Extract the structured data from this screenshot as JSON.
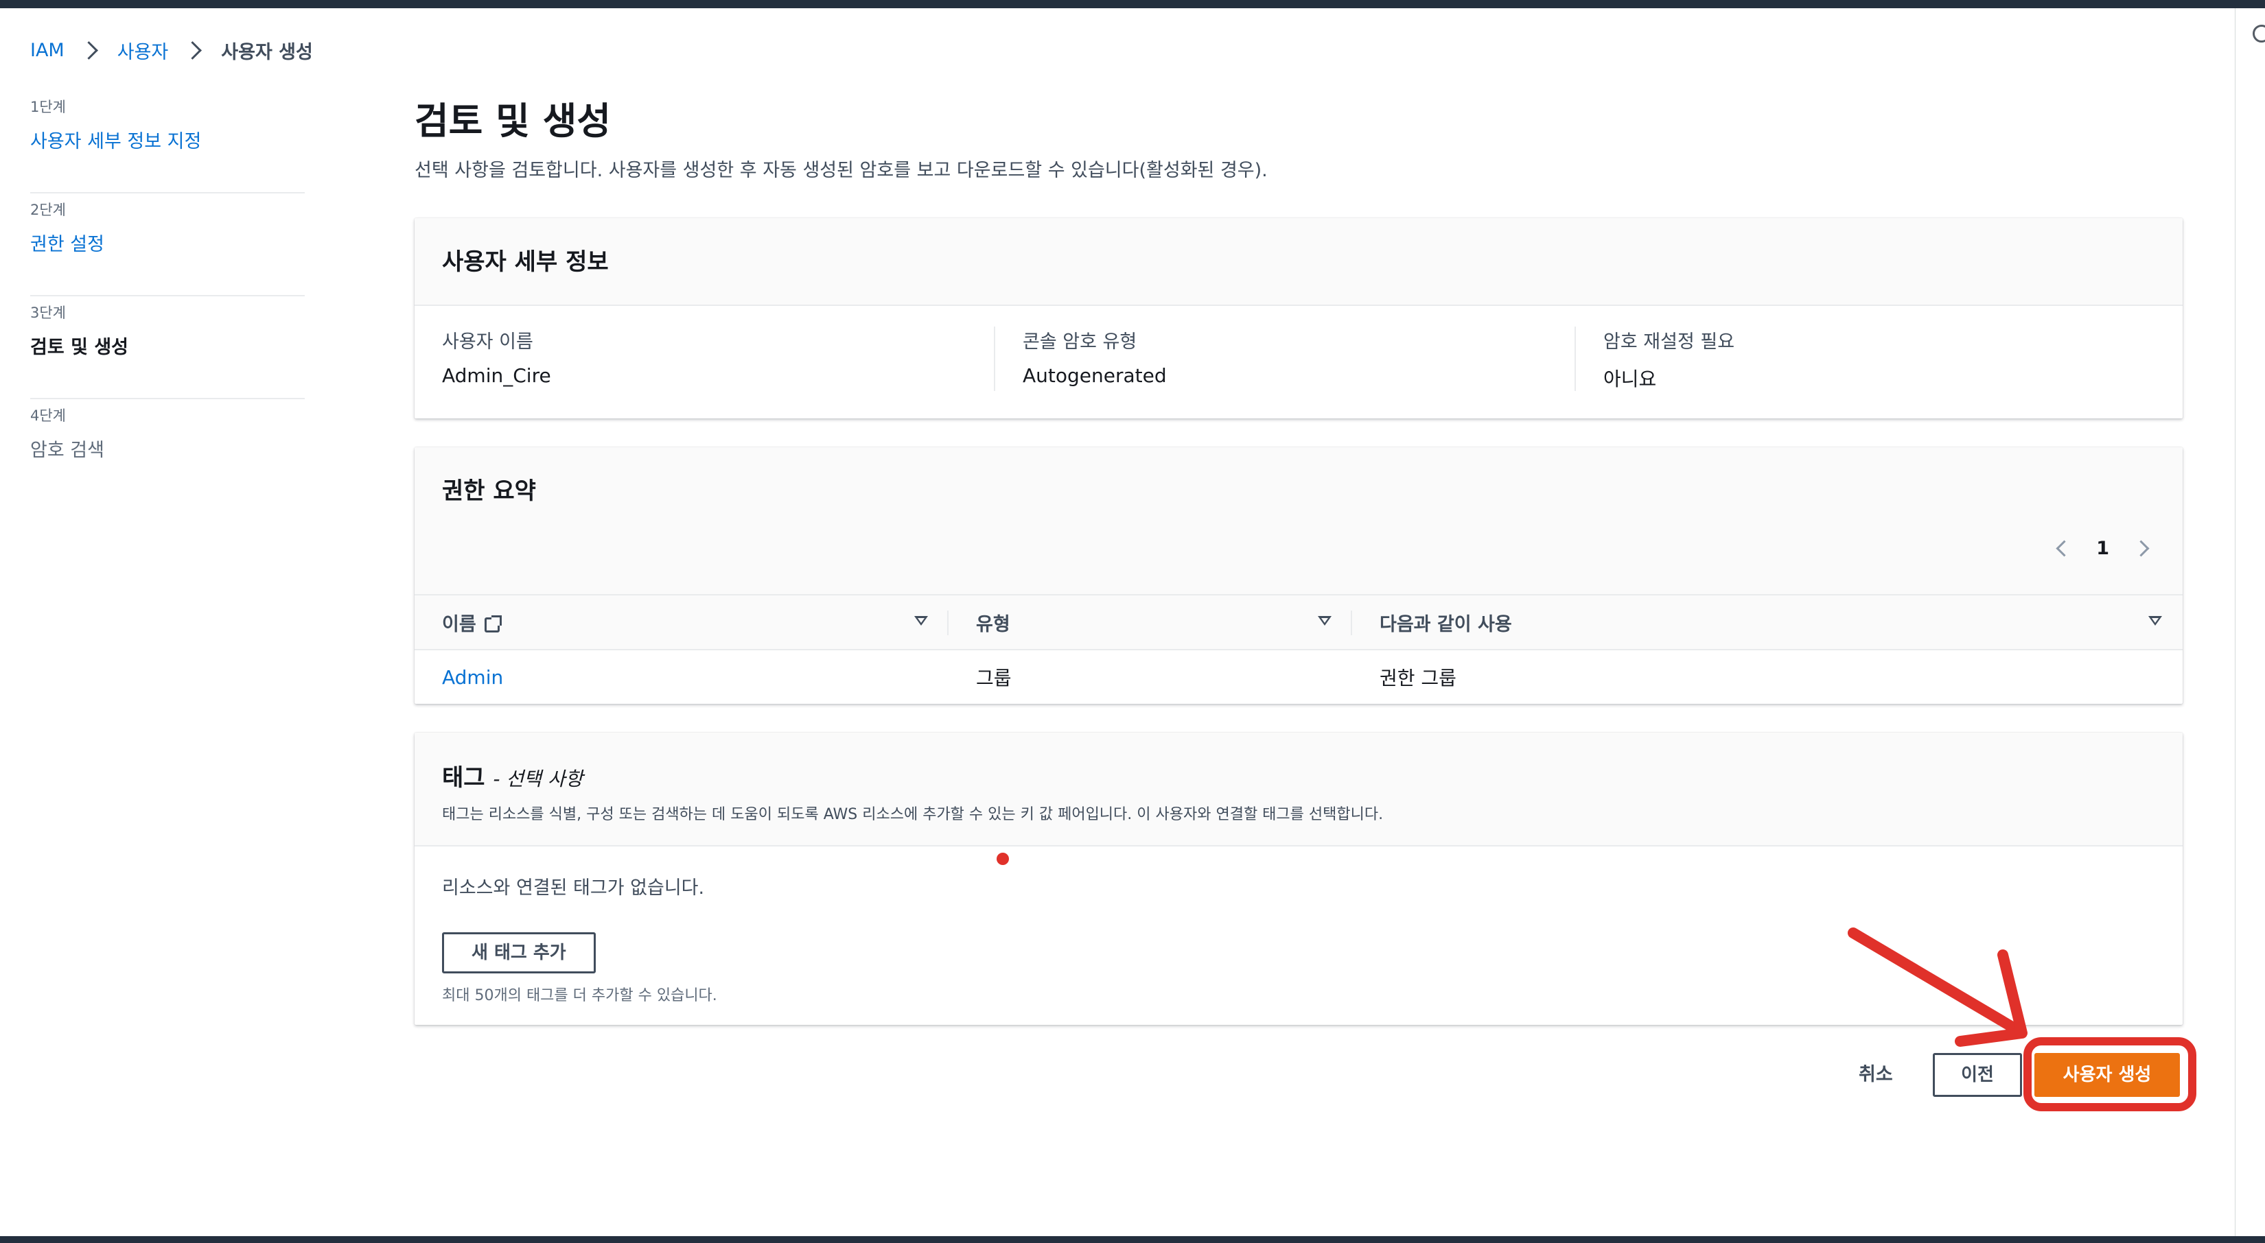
{
  "breadcrumb": {
    "items": [
      "IAM",
      "사용자"
    ],
    "current": "사용자 생성"
  },
  "steps": [
    {
      "number": "1단계",
      "label": "사용자 세부 정보 지정",
      "state": "link"
    },
    {
      "number": "2단계",
      "label": "권한 설정",
      "state": "link"
    },
    {
      "number": "3단계",
      "label": "검토 및 생성",
      "state": "current"
    },
    {
      "number": "4단계",
      "label": "암호 검색",
      "state": "disabled"
    }
  ],
  "page": {
    "title": "검토 및 생성",
    "description": "선택 사항을 검토합니다. 사용자를 생성한 후 자동 생성된 암호를 보고 다운로드할 수 있습니다(활성화된 경우)."
  },
  "user_details": {
    "title": "사용자 세부 정보",
    "fields": [
      {
        "key": "사용자 이름",
        "value": "Admin_Cire"
      },
      {
        "key": "콘솔 암호 유형",
        "value": "Autogenerated"
      },
      {
        "key": "암호 재설정 필요",
        "value": "아니요"
      }
    ]
  },
  "permissions": {
    "title": "권한 요약",
    "page_number": "1",
    "columns": [
      "이름",
      "유형",
      "다음과 같이 사용"
    ],
    "rows": [
      {
        "name": "Admin",
        "type": "그룹",
        "used_as": "권한 그룹"
      }
    ]
  },
  "tags": {
    "title": "태그",
    "optional": "- 선택 사항",
    "description": "태그는 리소스를 식별, 구성 또는 검색하는 데 도움이 되도록 AWS 리소스에 추가할 수 있는 키 값 페어입니다. 이 사용자와 연결할 태그를 선택합니다.",
    "empty_text": "리소스와 연결된 태그가 없습니다.",
    "add_button": "새 태그 추가",
    "limit_text": "최대 50개의 태그를 더 추가할 수 있습니다."
  },
  "footer": {
    "cancel": "취소",
    "previous": "이전",
    "create": "사용자 생성"
  },
  "colors": {
    "primary_button": "#ec7211",
    "link": "#0972d3",
    "annotation": "#e0312a",
    "top_bar": "#232f3e"
  }
}
